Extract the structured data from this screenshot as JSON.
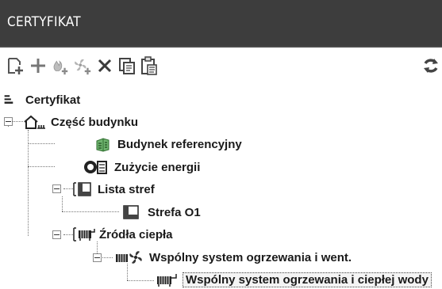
{
  "window": {
    "title": "CERTYFIKAT"
  },
  "toolbar": {
    "buttons": [
      {
        "name": "add-document",
        "icon": "add-document-icon"
      },
      {
        "name": "add",
        "icon": "plus-icon"
      },
      {
        "name": "add-heat",
        "icon": "add-flame-icon"
      },
      {
        "name": "add-ventilation",
        "icon": "add-fan-icon"
      },
      {
        "name": "delete",
        "icon": "delete-x-icon"
      },
      {
        "name": "copy",
        "icon": "copy-icon"
      },
      {
        "name": "paste",
        "icon": "paste-icon"
      },
      {
        "name": "refresh",
        "icon": "refresh-icon"
      }
    ]
  },
  "tree": {
    "root": {
      "label": "Certyfikat",
      "icon": "list-icon"
    },
    "items": [
      {
        "label": "Część budynku",
        "icon": "building-part-icon",
        "expanded": true
      },
      {
        "label": "Budynek referencyjny",
        "icon": "reference-building-icon"
      },
      {
        "label": "Zużycie energii",
        "icon": "energy-meter-icon"
      },
      {
        "label": "Lista stref",
        "icon": "zone-list-icon",
        "expanded": true
      },
      {
        "label": "Strefa O1",
        "icon": "zone-icon"
      },
      {
        "label": "Źródła ciepła",
        "icon": "heat-sources-icon",
        "expanded": true
      },
      {
        "label": "Wspólny system ogrzewania i went.",
        "icon": "heating-ventilation-icon",
        "expanded": true
      },
      {
        "label": "Wspólny system ogrzewania i ciepłej wody",
        "icon": "radiator-icon",
        "selected": true
      }
    ]
  },
  "colors": {
    "titlebar": "#3d3d3d",
    "toolbar_icons": "#5a5a5a",
    "selected_bg": "#f4f4f4"
  }
}
